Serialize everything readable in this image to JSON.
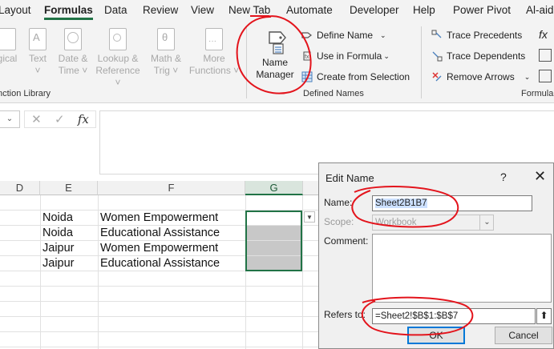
{
  "ribbon_tabs": [
    "Layout",
    "Formulas",
    "Data",
    "Review",
    "View",
    "New Tab",
    "Automate",
    "Developer",
    "Help",
    "Power Pivot",
    "Al-aid"
  ],
  "function_library": {
    "buttons": [
      {
        "line1": "gical",
        "line2": ""
      },
      {
        "line1": "Text",
        "line2": "˅"
      },
      {
        "line1": "Date &",
        "line2": "Time ˅"
      },
      {
        "line1": "Lookup &",
        "line2": "Reference ˅"
      },
      {
        "line1": "Math &",
        "line2": "Trig ˅"
      },
      {
        "line1": "More",
        "line2": "Functions ˅"
      }
    ],
    "group_label": "nction Library"
  },
  "defined_names": {
    "name_manager_line1": "Name",
    "name_manager_line2": "Manager",
    "define_name": "Define Name",
    "use_in_formula": "Use in Formula",
    "create_from_selection": "Create from Selection",
    "group_label": "Defined Names"
  },
  "formula_auditing": {
    "trace_precedents": "Trace Precedents",
    "trace_dependents": "Trace Dependents",
    "remove_arrows": "Remove Arrows",
    "group_label": "Formula"
  },
  "formula_bar": {
    "fx": "fx"
  },
  "columns": [
    "D",
    "E",
    "F",
    "G"
  ],
  "rows": [
    {
      "city": "Noida",
      "program": "Women Empowerment"
    },
    {
      "city": "Noida",
      "program": "Educational Assistance"
    },
    {
      "city": "Jaipur",
      "program": "Women Empowerment"
    },
    {
      "city": "Jaipur",
      "program": "Educational Assistance"
    }
  ],
  "dialog": {
    "title": "Edit Name",
    "help": "?",
    "close": "✕",
    "name_label": "Name:",
    "name_value": "Sheet2B1B7",
    "scope_label": "Scope:",
    "scope_value": "Workbook",
    "comment_label": "Comment:",
    "refers_label": "Refers to:",
    "refers_value": "=Sheet2!$B$1:$B$7",
    "ok": "OK",
    "cancel": "Cancel"
  },
  "colors": {
    "accent": "#217346",
    "annotation": "#e3141c",
    "dialog_focus": "#0078d7"
  }
}
